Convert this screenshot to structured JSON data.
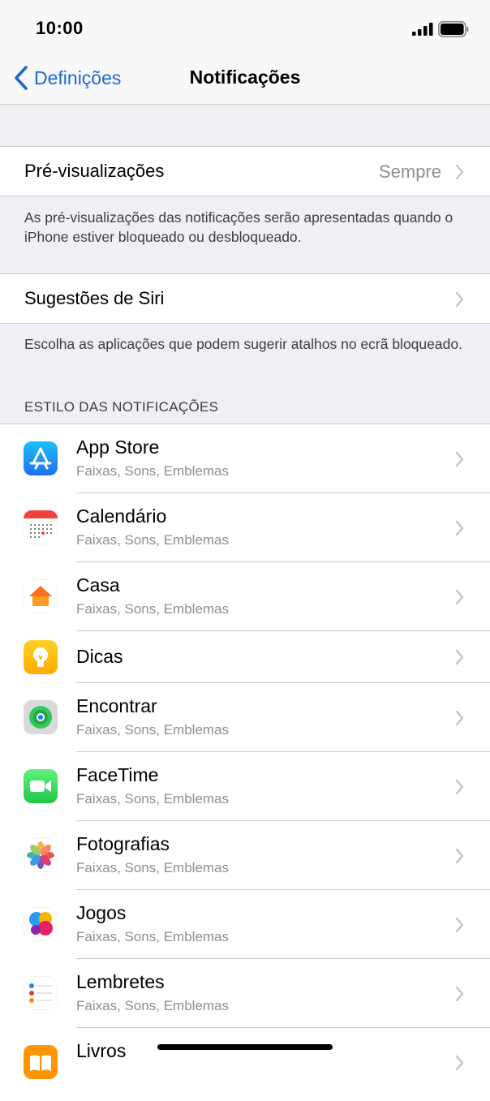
{
  "status_bar": {
    "time": "10:00"
  },
  "nav": {
    "back_label": "Definições",
    "title": "Notificações"
  },
  "previews": {
    "label": "Pré-visualizações",
    "value": "Sempre",
    "footer": "As pré-visualizações das notificações serão apresentadas quando o iPhone estiver bloqueado ou desbloqueado."
  },
  "siri": {
    "label": "Sugestões de Siri",
    "footer": "Escolha as aplicações que podem sugerir atalhos no ecrã bloqueado."
  },
  "style_header": "ESTILO DAS NOTIFICAÇÕES",
  "apps": [
    {
      "name": "App Store",
      "subtitle": "Faixas, Sons, Emblemas",
      "icon": "app-store-icon"
    },
    {
      "name": "Calendário",
      "subtitle": "Faixas, Sons, Emblemas",
      "icon": "calendar-icon"
    },
    {
      "name": "Casa",
      "subtitle": "Faixas, Sons, Emblemas",
      "icon": "home-icon"
    },
    {
      "name": "Dicas",
      "subtitle": "",
      "icon": "tips-icon"
    },
    {
      "name": "Encontrar",
      "subtitle": "Faixas, Sons, Emblemas",
      "icon": "find-my-icon"
    },
    {
      "name": "FaceTime",
      "subtitle": "Faixas, Sons, Emblemas",
      "icon": "facetime-icon"
    },
    {
      "name": "Fotografias",
      "subtitle": "Faixas, Sons, Emblemas",
      "icon": "photos-icon"
    },
    {
      "name": "Jogos",
      "subtitle": "Faixas, Sons, Emblemas",
      "icon": "game-center-icon"
    },
    {
      "name": "Lembretes",
      "subtitle": "Faixas, Sons, Emblemas",
      "icon": "reminders-icon"
    },
    {
      "name": "Livros",
      "subtitle": "",
      "icon": "books-icon"
    }
  ],
  "colors": {
    "accent": "#1d68d2",
    "background": "#efeff4",
    "secondary_text": "#8e8e93"
  }
}
